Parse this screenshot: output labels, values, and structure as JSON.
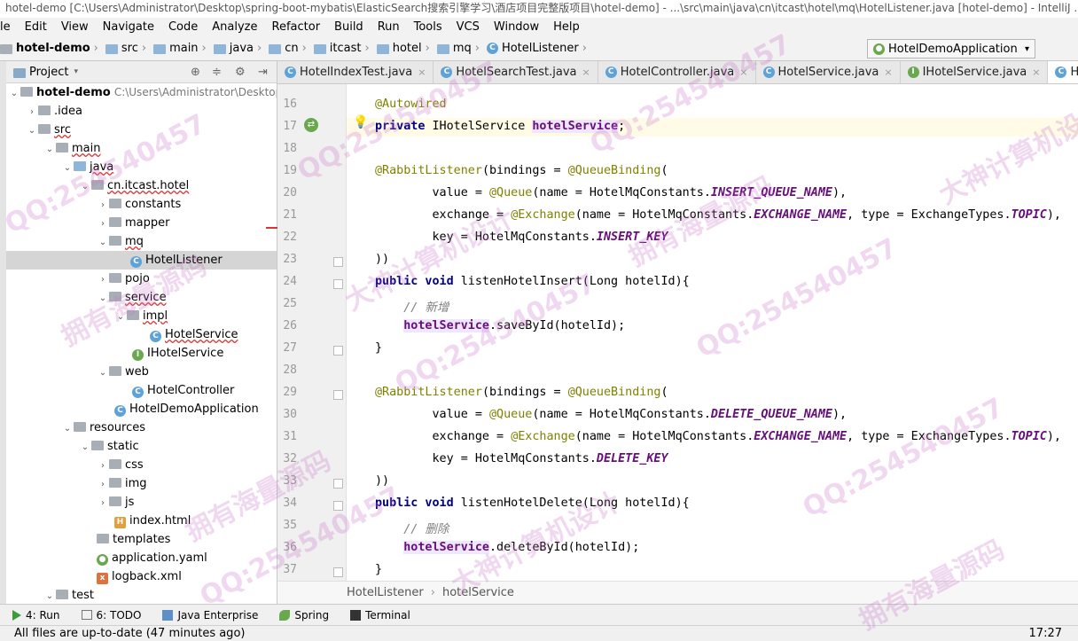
{
  "window": {
    "title": "hotel-demo [C:\\Users\\Administrator\\Desktop\\spring-boot-mybatis\\ElasticSearch搜索引擎学习\\酒店项目完整版项目\\hotel-demo] - ...\\src\\main\\java\\cn\\itcast\\hotel\\mq\\HotelListener.java [hotel-demo] - IntelliJ ..."
  },
  "menu": [
    "le",
    "Edit",
    "View",
    "Navigate",
    "Code",
    "Analyze",
    "Refactor",
    "Build",
    "Run",
    "Tools",
    "VCS",
    "Window",
    "Help"
  ],
  "nav": {
    "crumbs": [
      "hotel-demo",
      "src",
      "main",
      "java",
      "cn",
      "itcast",
      "hotel",
      "mq",
      "HotelListener"
    ],
    "run_config": "HotelDemoApplication"
  },
  "project": {
    "header": "Project",
    "tree": [
      {
        "label": "hotel-demo",
        "extra": "C:\\Users\\Administrator\\Desktop"
      },
      {
        "label": ".idea"
      },
      {
        "label": "src"
      },
      {
        "label": "main"
      },
      {
        "label": "java"
      },
      {
        "label": "cn.itcast.hotel"
      },
      {
        "label": "constants"
      },
      {
        "label": "mapper"
      },
      {
        "label": "mq"
      },
      {
        "label": "HotelListener"
      },
      {
        "label": "pojo"
      },
      {
        "label": "service"
      },
      {
        "label": "impl"
      },
      {
        "label": "HotelService"
      },
      {
        "label": "IHotelService"
      },
      {
        "label": "web"
      },
      {
        "label": "HotelController"
      },
      {
        "label": "HotelDemoApplication"
      },
      {
        "label": "resources"
      },
      {
        "label": "static"
      },
      {
        "label": "css"
      },
      {
        "label": "img"
      },
      {
        "label": "js"
      },
      {
        "label": "index.html"
      },
      {
        "label": "templates"
      },
      {
        "label": "application.yaml"
      },
      {
        "label": "logback.xml"
      },
      {
        "label": "test"
      }
    ]
  },
  "tabs": [
    "HotelIndexTest.java",
    "HotelSearchTest.java",
    "HotelController.java",
    "HotelService.java",
    "IHotelService.java",
    "HotelListener.java"
  ],
  "code": {
    "line_numbers": [
      "16",
      "17",
      "18",
      "19",
      "20",
      "21",
      "22",
      "23",
      "24",
      "25",
      "26",
      "27",
      "28",
      "29",
      "30",
      "31",
      "32",
      "33",
      "34",
      "35",
      "36",
      "37"
    ],
    "t": {
      "autowired": "@Autowired",
      "private": "private",
      "ihotelservice": " IHotelService ",
      "field": "hotelService",
      "semi": ";",
      "rabbit": "@RabbitListener",
      "bindings": "(bindings = ",
      "qb": "@QueueBinding",
      "paren": "(",
      "value_eq": "        value = ",
      "queue": "@Queue",
      "name_eq": "(name = HotelMqConstants.",
      "insert_queue": "INSERT_QUEUE_NAME",
      "delete_queue": "DELETE_QUEUE_NAME",
      "close_comma": "),",
      "exchange_eq": "        exchange = ",
      "exchange": "@Exchange",
      "exchange_name": "EXCHANGE_NAME",
      "type_eq": ", type = ExchangeTypes.",
      "topic": "TOPIC",
      "key_eq": "        key = HotelMqConstants.",
      "insert_key": "INSERT_KEY",
      "delete_key": "DELETE_KEY",
      "closeclose": "))",
      "public": "public",
      "void": " void",
      "insert_sig": " listenHotelInsert(Long hotelId){",
      "delete_sig": " listenHotelDelete(Long hotelId){",
      "indent": "    ",
      "cm_add": "// 新增",
      "cm_del": "// 删除",
      "save_call": ".saveById(hotelId);",
      "delete_call": ".deleteById(hotelId);",
      "close_brace": "}"
    }
  },
  "editor_breadcrumb": [
    "HotelListener",
    "hotelService"
  ],
  "tool_windows": [
    "4: Run",
    "6: TODO",
    "Java Enterprise",
    "Spring",
    "Terminal"
  ],
  "status": {
    "message": "All files are up-to-date (47 minutes ago)",
    "time": "17:27"
  },
  "watermark": [
    "QQ:254540457",
    "大神计算机设计",
    "拥有海量源码"
  ]
}
